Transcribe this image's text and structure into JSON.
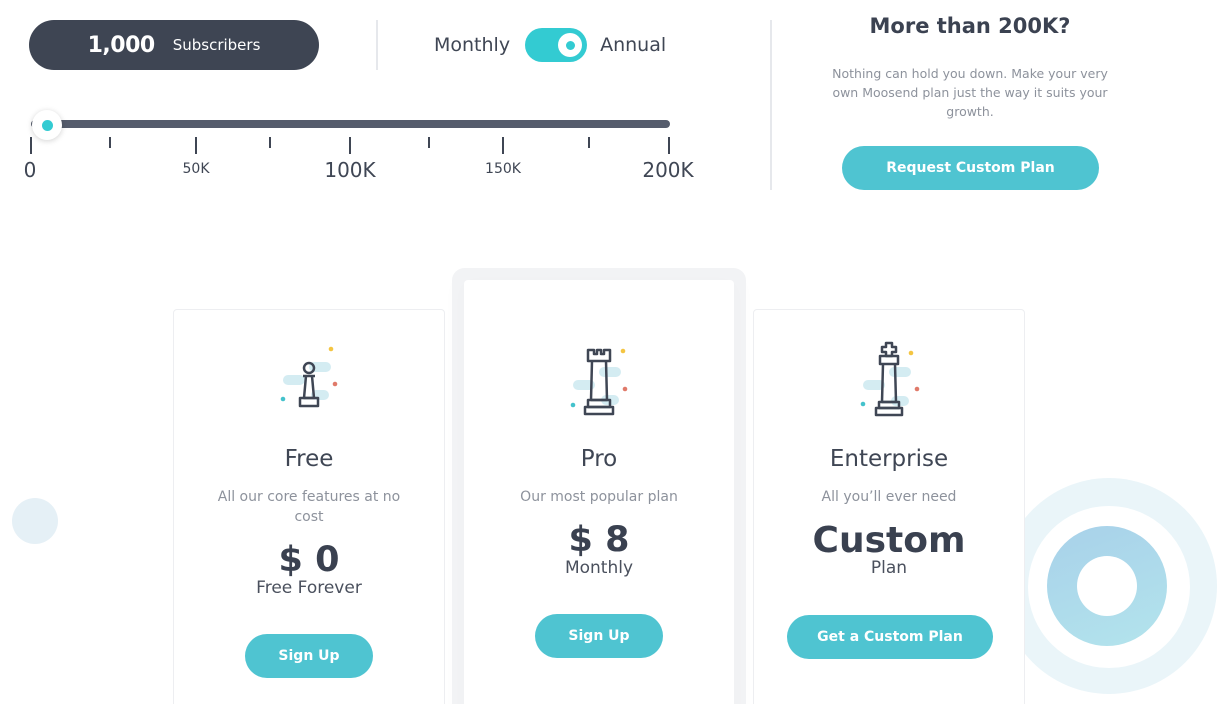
{
  "subscribers": {
    "count": "1,000",
    "label": "Subscribers"
  },
  "billing": {
    "monthly_label": "Monthly",
    "annual_label": "Annual",
    "selected": "Annual"
  },
  "slider": {
    "value": 1000,
    "min": 0,
    "max": 200000,
    "labels": [
      "0",
      "50K",
      "100K",
      "150K",
      "200K"
    ]
  },
  "custom_offer": {
    "title": "More than 200K?",
    "description": "Nothing can hold you down. Make your very own Moosend plan just the way it suits your growth.",
    "button_label": "Request Custom Plan"
  },
  "plans": [
    {
      "name": "Free",
      "description": "All our core features at no cost",
      "price": "$ 0",
      "period": "Free Forever",
      "button_label": "Sign Up",
      "icon": "chess-pawn-icon"
    },
    {
      "name": "Pro",
      "description": "Our most popular plan",
      "price": "$ 8",
      "period": "Monthly",
      "button_label": "Sign Up",
      "icon": "chess-rook-icon"
    },
    {
      "name": "Enterprise",
      "description": "All you’ll ever need",
      "price": "Custom",
      "period": "Plan",
      "button_label": "Get a Custom Plan",
      "icon": "chess-king-icon"
    }
  ],
  "colors": {
    "accent": "#33cbd2",
    "button": "#4fc4d1",
    "dark": "#3e4553",
    "muted_text": "#8d929c"
  }
}
